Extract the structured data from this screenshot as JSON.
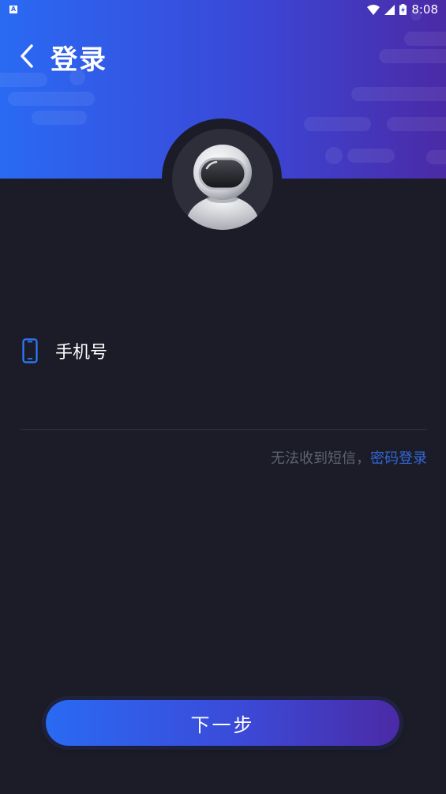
{
  "status_bar": {
    "time": "8:08",
    "notification_icon": "a-square-icon"
  },
  "header": {
    "title": "登录",
    "back_icon": "chevron-left-icon"
  },
  "avatar": {
    "alt": "astronaut-avatar"
  },
  "form": {
    "phone_label": "手机号",
    "phone_icon": "phone-icon",
    "phone_value": "",
    "phone_placeholder": ""
  },
  "sms_help": {
    "text": "无法收到短信，",
    "link": "密码登录"
  },
  "next_button": {
    "label": "下一步"
  },
  "colors": {
    "background": "#1b1c28",
    "gradient_start": "#2a6af3",
    "gradient_end": "#4b2aa6",
    "link": "#3366d6",
    "muted_text": "#5f6270",
    "icon_blue": "#2f7bff"
  }
}
